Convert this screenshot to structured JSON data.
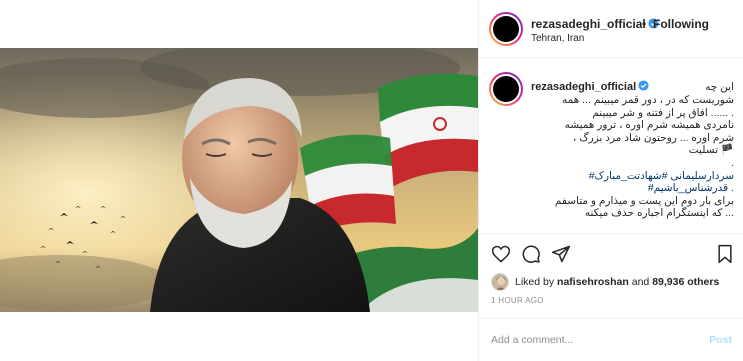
{
  "header": {
    "username": "rezasadeghi_official",
    "separator": "•",
    "follow_status": "Following",
    "location": "Tehran, Iran"
  },
  "caption": {
    "username": "rezasadeghi_official",
    "lines": [
      "این چه",
      "شوریست که در ، دور قمر میبینم ... همه",
      ". ...... افاق پر از فتنه و شر میبینم",
      "نامردی همیشه شرم اوره ، ترور همیشه",
      "شرم اوره ... روحتون شاد مرد بزرگ ،",
      "🏴 تسلیت",
      ".",
      "سردارسلیمانی #شهادتت_مبارک#",
      ". قدرشناس_باشیم#",
      "برای بار دوم این پست و میذارم و متاسفم",
      "... که اینستگرام اجباره حذف میکنه"
    ]
  },
  "likes": {
    "prefix": "Liked by",
    "user": "nafisehroshan",
    "middle": "and",
    "count": "89,936 others"
  },
  "time": "1 HOUR AGO",
  "comment_box": {
    "placeholder": "Add a comment...",
    "post_label": "Post"
  },
  "colors": {
    "link": "#00376b",
    "post_disabled": "#b2dffc",
    "verified": "#3897f0"
  }
}
